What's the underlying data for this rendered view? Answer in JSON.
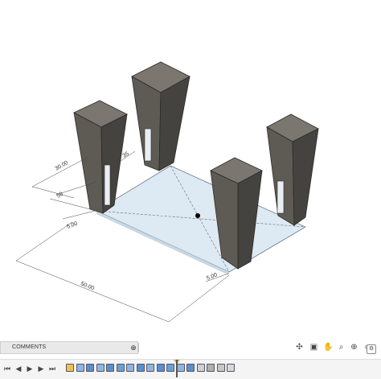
{
  "viewport": {
    "dimensions": {
      "d1": "30.00",
      "d2": "35",
      "d3": "50",
      "d4": "5.00",
      "d5": "50.00",
      "d6": "5.00"
    }
  },
  "comments": {
    "label": "COMMENTS",
    "add": "⊕"
  },
  "nav": {
    "icons": [
      "orbit-icon",
      "look-at-icon",
      "pan-icon",
      "zoom-icon",
      "fit-icon",
      "display-settings-icon"
    ]
  },
  "timeline": {
    "playback": [
      "first-icon",
      "previous-icon",
      "play-icon",
      "next-icon",
      "last-icon"
    ],
    "feature_count": 17
  },
  "colors": {
    "leg_front": "#6a665f",
    "leg_side": "#4a4844",
    "leg_top": "#7b7770",
    "plate": "#ddeaf4"
  }
}
